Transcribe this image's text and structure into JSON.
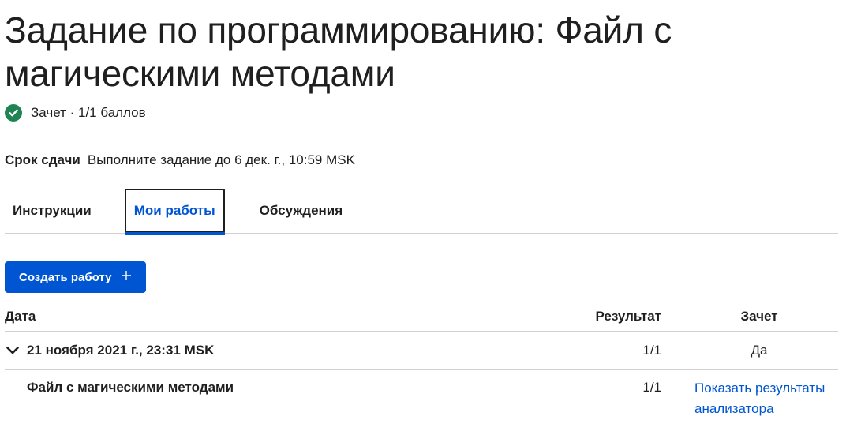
{
  "title": "Задание по программированию: Файл с магическими методами",
  "status": {
    "icon": "check-circle-icon",
    "text": "Зачет · 1/1 баллов",
    "color": "#1f8354"
  },
  "deadline": {
    "label": "Срок сдачи",
    "text": "Выполните задание до 6 дек. г., 10:59 MSK"
  },
  "tabs": [
    {
      "label": "Инструкции"
    },
    {
      "label": "Мои работы",
      "active": true
    },
    {
      "label": "Обсуждения"
    }
  ],
  "create_button": {
    "label": "Создать работу",
    "icon": "plus-icon",
    "color": "#0056d2"
  },
  "table": {
    "headers": {
      "date": "Дата",
      "result": "Результат",
      "pass": "Зачет"
    },
    "submission": {
      "date": "21 ноября 2021 г., 23:31 MSK",
      "result": "1/1",
      "pass": "Да",
      "expand_icon": "chevron-down-icon"
    },
    "file": {
      "name": "Файл с магическими методами",
      "result": "1/1",
      "link": "Показать результаты анализатора"
    }
  },
  "colors": {
    "accent": "#0056d2",
    "text": "#1f1f1f",
    "divider": "#d1d1d1"
  }
}
